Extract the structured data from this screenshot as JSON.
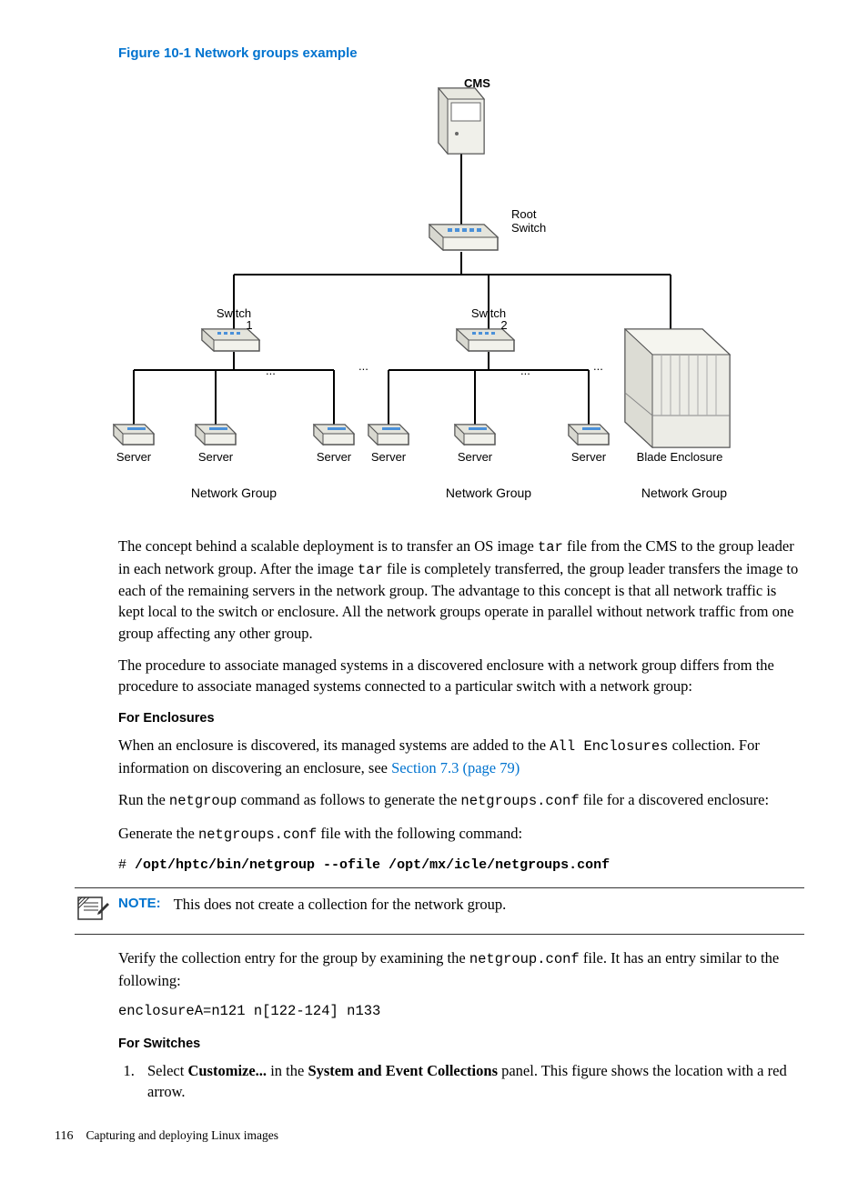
{
  "figure": {
    "caption": "Figure 10-1 Network groups example",
    "labels": {
      "cms": "CMS",
      "root_switch_l1": "Root",
      "root_switch_l2": "Switch",
      "switch_l1": "Switch",
      "switch1_l2": "1",
      "switch2_l2": "2",
      "server": "Server",
      "blade": "Blade Enclosure",
      "netgroup": "Network Group",
      "ellipsis": "..."
    }
  },
  "p1_a": "The concept behind a scalable deployment is to transfer an OS image ",
  "p1_tar1": "tar",
  "p1_b": " file from the CMS to the group leader in each network group. After the image ",
  "p1_tar2": "tar",
  "p1_c": " file is completely transferred, the group leader transfers the image to each of the remaining servers in the network group. The advantage to this concept is that all network traffic is kept local to the switch or enclosure. All the network groups operate in parallel without network traffic from one group affecting any other group.",
  "p2": "The procedure to associate managed systems in a discovered enclosure with a network group differs from the procedure to associate managed systems connected to a particular switch with a network group:",
  "enclosures": {
    "heading": "For Enclosures",
    "p1_a": "When an enclosure is discovered, its managed systems are added to the ",
    "p1_code": "All Enclosures",
    "p1_b": " collection. For information on discovering an enclosure, see ",
    "link": "Section 7.3 (page 79)",
    "p2_a": "Run the ",
    "p2_code1": "netgroup",
    "p2_b": " command as follows to generate the ",
    "p2_code2": "netgroups.conf",
    "p2_c": " file for a discovered enclosure:",
    "p3_a": "Generate the ",
    "p3_code": "netgroups.conf",
    "p3_b": " file with the following command:",
    "cmd_prompt": "# ",
    "cmd": "/opt/hptc/bin/netgroup --ofile /opt/mx/icle/netgroups.conf",
    "note_label": "NOTE:",
    "note_text": "This does not create a collection for the network group.",
    "p4_a": "Verify the collection entry for the group by examining the ",
    "p4_code": "netgroup.conf",
    "p4_b": " file. It has an entry similar to the following:",
    "sample": "enclosureA=n121 n[122-124] n133"
  },
  "switches": {
    "heading": "For Switches",
    "step1_a": "Select ",
    "step1_b": "Customize...",
    "step1_c": " in the ",
    "step1_d": "System and Event Collections",
    "step1_e": " panel. This figure shows the location with a red arrow."
  },
  "footer": {
    "page": "116",
    "chapter": "Capturing and deploying Linux images"
  }
}
